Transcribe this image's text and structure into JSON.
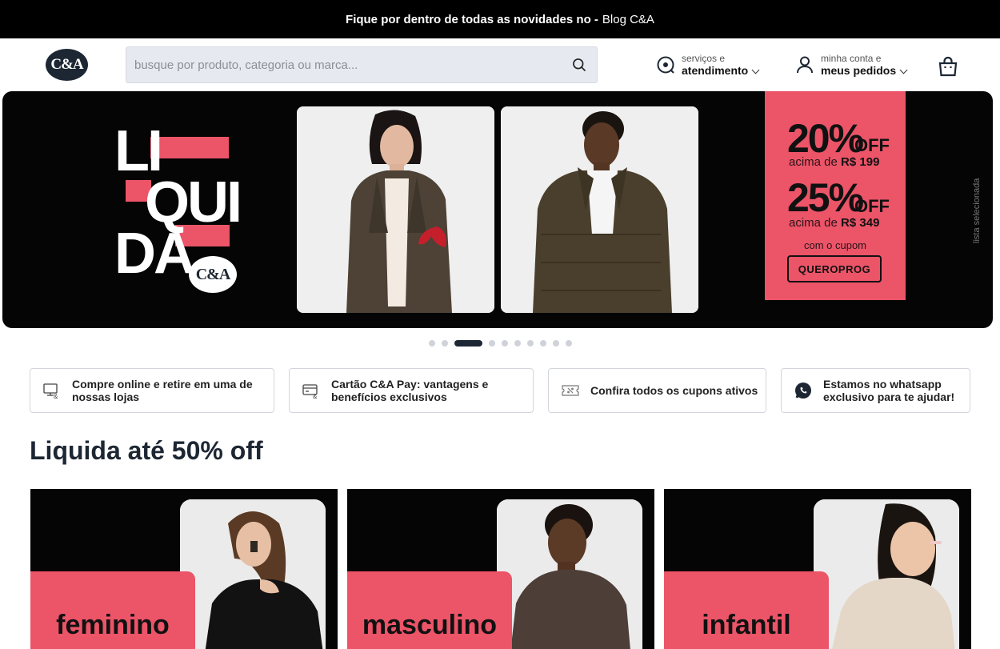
{
  "topbar": {
    "message": "Fique por dentro de todas as novidades no -",
    "link": "Blog C&A"
  },
  "header": {
    "logo_text": "C&A",
    "search_placeholder": "busque por produto, categoria ou marca...",
    "service": {
      "small": "serviços e",
      "big": "atendimento"
    },
    "account": {
      "small": "minha conta e",
      "big": "meus pedidos"
    }
  },
  "banner": {
    "headline_lines": [
      "LI",
      "QUI",
      "DA"
    ],
    "logo_text": "C&A",
    "promo": {
      "pct1": "20%",
      "off1": "OFF",
      "min1_prefix": "acima de",
      "min1_value": "R$ 199",
      "pct2": "25%",
      "off2": "OFF",
      "min2_prefix": "acima de",
      "min2_value": "R$ 349",
      "coupon_label": "com o cupom",
      "coupon_code": "QUEROPROG"
    },
    "side_label": "lista selecionada",
    "active_slide": 3,
    "slide_count": 11
  },
  "info_cards": [
    {
      "icon": "store-pickup-icon",
      "text": "Compre online e retire em uma de nossas lojas"
    },
    {
      "icon": "card-icon",
      "text": "Cartão C&A Pay: vantagens e benefícios exclusivos"
    },
    {
      "icon": "coupon-icon",
      "text": "Confira todos os cupons ativos"
    },
    {
      "icon": "whatsapp-icon",
      "text": "Estamos no whatsapp exclusivo para te ajudar!"
    }
  ],
  "section": {
    "title": "Liquida até 50% off",
    "categories": [
      {
        "label": "feminino"
      },
      {
        "label": "masculino"
      },
      {
        "label": "infantil"
      }
    ]
  },
  "colors": {
    "accent": "#ec5468",
    "dark": "#1d2733",
    "banner_bg": "#050505"
  }
}
